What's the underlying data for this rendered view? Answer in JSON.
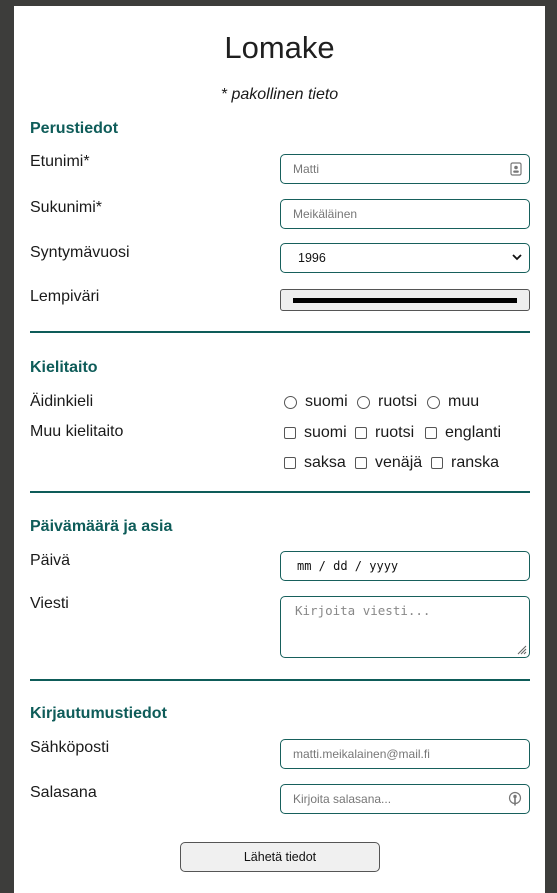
{
  "form": {
    "title": "Lomake",
    "required_note": "* pakollinen tieto",
    "submit_label": "Lähetä tiedot"
  },
  "basic_info": {
    "heading": "Perustiedot",
    "first_name_label": "Etunimi*",
    "first_name_placeholder": "Matti",
    "last_name_label": "Sukunimi*",
    "last_name_placeholder": "Meikäläinen",
    "birth_year_label": "Syntymävuosi",
    "birth_year_value": "1996",
    "favorite_color_label": "Lempiväri",
    "favorite_color_value": "#000000"
  },
  "languages": {
    "heading": "Kielitaito",
    "native_label": "Äidinkieli",
    "native_options": [
      "suomi",
      "ruotsi",
      "muu"
    ],
    "other_label": "Muu kielitaito",
    "other_options": [
      "suomi",
      "ruotsi",
      "englanti",
      "saksa",
      "venäjä",
      "ranska"
    ]
  },
  "date_subject": {
    "heading": "Päivämäärä ja asia",
    "date_label": "Päivä",
    "date_placeholder": "mm / dd / yyyy",
    "message_label": "Viesti",
    "message_placeholder": "Kirjoita viesti..."
  },
  "login": {
    "heading": "Kirjautumustiedot",
    "email_label": "Sähköposti",
    "email_placeholder": "matti.meikalainen@mail.fi",
    "password_label": "Salasana",
    "password_placeholder": "Kirjoita salasana..."
  },
  "icons": {
    "autofill": "contact-card-icon",
    "password_manager": "key-icon",
    "dropdown": "chevron-down-icon",
    "resize": "resize-handle-icon"
  },
  "colors": {
    "accent": "#0e5c59",
    "frame": "#3d3d3b"
  }
}
